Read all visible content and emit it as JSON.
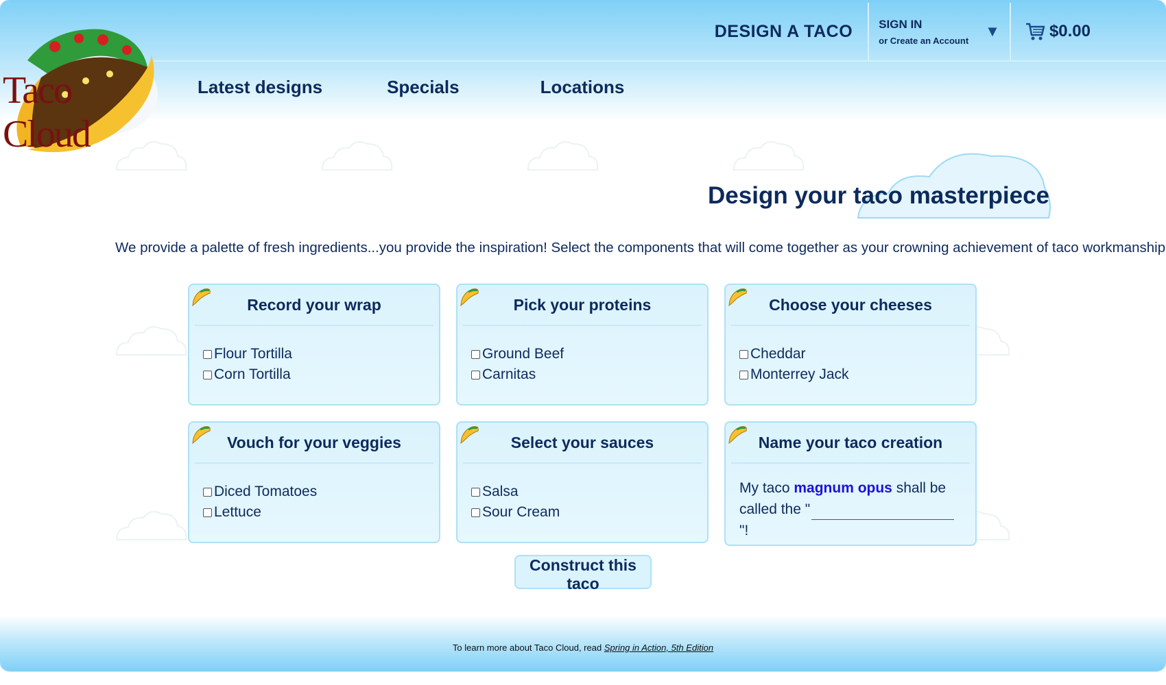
{
  "brand": {
    "logo_text": "Taco Cloud"
  },
  "header": {
    "design_label": "DESIGN A TACO",
    "signin_title": "SIGN IN",
    "signin_sub": "or Create an Account",
    "cart_total": "$0.00"
  },
  "nav": [
    {
      "label": "Latest designs"
    },
    {
      "label": "Specials"
    },
    {
      "label": "Locations"
    }
  ],
  "page": {
    "title": "Design your taco masterpiece",
    "intro": "We provide a palette of fresh ingredients...you provide the inspiration! Select the components that will come together as your crowning achievement of taco workmanship."
  },
  "groups": [
    {
      "title": "Record your wrap",
      "options": [
        "Flour Tortilla",
        "Corn Tortilla"
      ]
    },
    {
      "title": "Pick your proteins",
      "options": [
        "Ground Beef",
        "Carnitas"
      ]
    },
    {
      "title": "Choose your cheeses",
      "options": [
        "Cheddar",
        "Monterrey Jack"
      ]
    },
    {
      "title": "Vouch for your veggies",
      "options": [
        "Diced Tomatoes",
        "Lettuce"
      ]
    },
    {
      "title": "Select your sauces",
      "options": [
        "Salsa",
        "Sour Cream"
      ]
    }
  ],
  "name_card": {
    "title": "Name your taco creation",
    "prefix": "My taco ",
    "emphasis": "magnum opus",
    "middle": " shall be called the \"",
    "suffix": "\"!",
    "input_value": ""
  },
  "submit_label": "Construct this taco",
  "footer": {
    "text": "To learn more about Taco Cloud, read ",
    "link": "Spring in Action, 5th Edition"
  },
  "colors": {
    "primary_text": "#0d2a5c",
    "card_bg": "#dbf3fd",
    "card_border": "#aee1f6",
    "emphasis": "#1a10e0",
    "logo_text": "#7a1010"
  }
}
